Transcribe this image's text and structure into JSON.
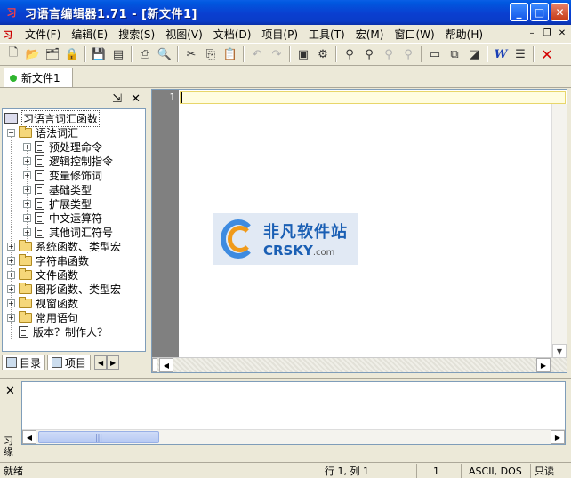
{
  "window": {
    "title": "习语言编辑器1.71 - [新文件1]",
    "app_icon": "习",
    "controls": [
      "minimize-icon",
      "maximize-icon",
      "close-icon"
    ]
  },
  "menu": {
    "mdi_icon": "习",
    "items": [
      "文件(F)",
      "编辑(E)",
      "搜索(S)",
      "视图(V)",
      "文档(D)",
      "项目(P)",
      "工具(T)",
      "宏(M)",
      "窗口(W)",
      "帮助(H)"
    ]
  },
  "toolbar": {
    "icons": [
      "new-icon",
      "open-icon",
      "open-project-icon",
      "lock-icon",
      "save-icon",
      "save-all-icon",
      "print-icon",
      "print-preview-icon",
      "cut-icon",
      "copy-icon",
      "paste-icon",
      "undo-icon",
      "redo-icon",
      "compile-icon",
      "run-icon",
      "find-icon",
      "find-next-icon",
      "replace-icon",
      "find-in-files-icon",
      "window-icon",
      "cascade-icon",
      "browser-icon",
      "word-wrap-icon",
      "list-icon",
      "close-doc-icon"
    ]
  },
  "tabs": {
    "doc_tab": "新文件1"
  },
  "tree": {
    "root": "习语言词汇函数",
    "group_open": "语法词汇",
    "children": [
      "预处理命令",
      "逻辑控制指令",
      "变量修饰词",
      "基础类型",
      "扩展类型",
      "中文运算符",
      "其他词汇符号"
    ],
    "groups": [
      "系统函数、类型宏",
      "字符串函数",
      "文件函数",
      "图形函数、类型宏",
      "视窗函数",
      "常用语句"
    ],
    "last_item": "版本？制作人？"
  },
  "left_tabs": {
    "catalog": "目录",
    "project": "项目"
  },
  "editor": {
    "line_number": "1"
  },
  "watermark": {
    "cn": "非凡软件站",
    "en": "CRSKY",
    "domain": ".com"
  },
  "output": {
    "label": "习 缘",
    "thumb_grip": "|||"
  },
  "status": {
    "ready": "就绪",
    "position": "行 1,  列 1",
    "number": "1",
    "encoding": "ASCII, DOS",
    "readonly": "只读"
  }
}
